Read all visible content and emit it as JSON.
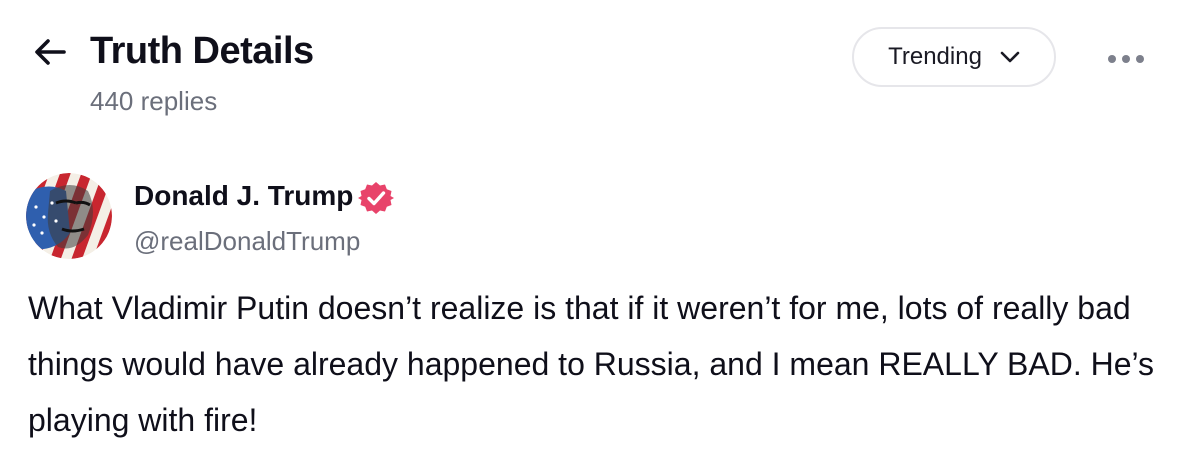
{
  "header": {
    "back_icon": "arrow-left-icon",
    "title": "Truth Details",
    "replies_count": "440 replies",
    "sort": {
      "selected": "Trending",
      "icon": "chevron-down-icon"
    },
    "more_icon": "more-horizontal-icon"
  },
  "post": {
    "author": {
      "name": "Donald J. Trump",
      "handle": "@realDonaldTrump",
      "verified": true,
      "verified_icon": "verified-badge-icon",
      "verified_color": "#e8436a"
    },
    "text": "What Vladimir Putin doesn’t realize is that if it weren’t for me, lots of really bad things would have already happened to Russia, and I mean REALLY BAD. He’s playing with fire!"
  },
  "colors": {
    "text_primary": "#0f0f1a",
    "text_secondary": "#6b6f7b",
    "border": "#e6e6ea",
    "accent": "#e8436a"
  }
}
